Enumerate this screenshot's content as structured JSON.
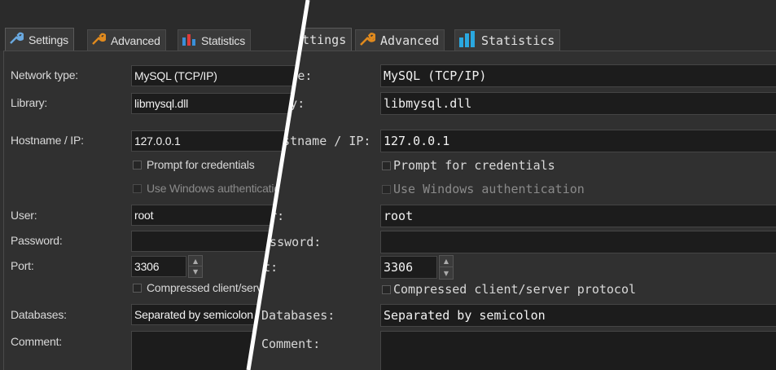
{
  "tabs": [
    {
      "label": "Settings",
      "icon": "wrench-icon"
    },
    {
      "label": "Advanced",
      "icon": "wrench-orange-icon"
    },
    {
      "label": "Statistics",
      "icon": "bar-chart-icon"
    }
  ],
  "form": {
    "network_type": {
      "label": "Network type:",
      "value": "MySQL (TCP/IP)"
    },
    "library": {
      "label": "Library:",
      "value": "libmysql.dll"
    },
    "hostname": {
      "label": "Hostname / IP:",
      "value": "127.0.0.1"
    },
    "prompt_credentials": {
      "label": "Prompt for credentials",
      "checked": false
    },
    "windows_auth": {
      "label": "Use Windows authentication",
      "checked": false,
      "enabled": false
    },
    "user": {
      "label": "User:",
      "value": "root"
    },
    "password": {
      "label": "Password:",
      "value": ""
    },
    "port": {
      "label": "Port:",
      "value": "3306"
    },
    "compressed": {
      "label": "Compressed client/server protocol",
      "checked": false
    },
    "databases": {
      "label": "Databases:",
      "value": "Separated by semicolon"
    },
    "comment": {
      "label": "Comment:",
      "value": ""
    }
  },
  "colors": {
    "background": "#303030",
    "field": "#1c1c1c",
    "divider": "#ffffff",
    "accent_blue": "#2aa8e0",
    "accent_orange": "#e08a1e"
  }
}
